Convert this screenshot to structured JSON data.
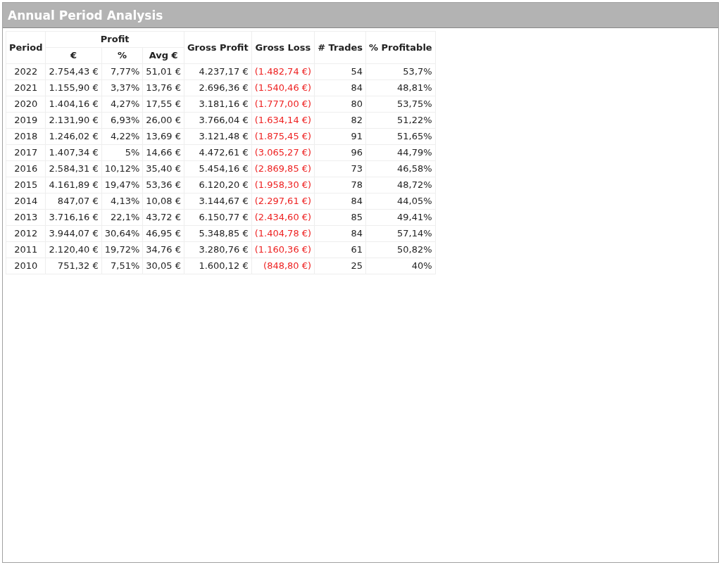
{
  "window": {
    "title": "Annual Period Analysis"
  },
  "table": {
    "columns": [
      {
        "label": "Period",
        "kind": "text"
      },
      {
        "label": "Profit",
        "colspan": 3,
        "children": [
          {
            "label": "€"
          },
          {
            "label": "%"
          },
          {
            "label": "Avg €"
          }
        ]
      },
      {
        "label": "Gross Profit",
        "kind": "number"
      },
      {
        "label": "Gross Loss",
        "kind": "loss"
      },
      {
        "label": "# Trades",
        "kind": "number"
      },
      {
        "label": "% Profitable",
        "kind": "number"
      }
    ],
    "rows": [
      [
        "2022",
        "2.754,43 €",
        "7,77%",
        "51,01 €",
        "4.237,17 €",
        "(1.482,74 €)",
        "54",
        "53,7%"
      ],
      [
        "2021",
        "1.155,90 €",
        "3,37%",
        "13,76 €",
        "2.696,36 €",
        "(1.540,46 €)",
        "84",
        "48,81%"
      ],
      [
        "2020",
        "1.404,16 €",
        "4,27%",
        "17,55 €",
        "3.181,16 €",
        "(1.777,00 €)",
        "80",
        "53,75%"
      ],
      [
        "2019",
        "2.131,90 €",
        "6,93%",
        "26,00 €",
        "3.766,04 €",
        "(1.634,14 €)",
        "82",
        "51,22%"
      ],
      [
        "2018",
        "1.246,02 €",
        "4,22%",
        "13,69 €",
        "3.121,48 €",
        "(1.875,45 €)",
        "91",
        "51,65%"
      ],
      [
        "2017",
        "1.407,34 €",
        "5%",
        "14,66 €",
        "4.472,61 €",
        "(3.065,27 €)",
        "96",
        "44,79%"
      ],
      [
        "2016",
        "2.584,31 €",
        "10,12%",
        "35,40 €",
        "5.454,16 €",
        "(2.869,85 €)",
        "73",
        "46,58%"
      ],
      [
        "2015",
        "4.161,89 €",
        "19,47%",
        "53,36 €",
        "6.120,20 €",
        "(1.958,30 €)",
        "78",
        "48,72%"
      ],
      [
        "2014",
        "847,07 €",
        "4,13%",
        "10,08 €",
        "3.144,67 €",
        "(2.297,61 €)",
        "84",
        "44,05%"
      ],
      [
        "2013",
        "3.716,16 €",
        "22,1%",
        "43,72 €",
        "6.150,77 €",
        "(2.434,60 €)",
        "85",
        "49,41%"
      ],
      [
        "2012",
        "3.944,07 €",
        "30,64%",
        "46,95 €",
        "5.348,85 €",
        "(1.404,78 €)",
        "84",
        "57,14%"
      ],
      [
        "2011",
        "2.120,40 €",
        "19,72%",
        "34,76 €",
        "3.280,76 €",
        "(1.160,36 €)",
        "61",
        "50,82%"
      ],
      [
        "2010",
        "751,32 €",
        "7,51%",
        "30,05 €",
        "1.600,12 €",
        "(848,80 €)",
        "25",
        "40%"
      ]
    ]
  }
}
